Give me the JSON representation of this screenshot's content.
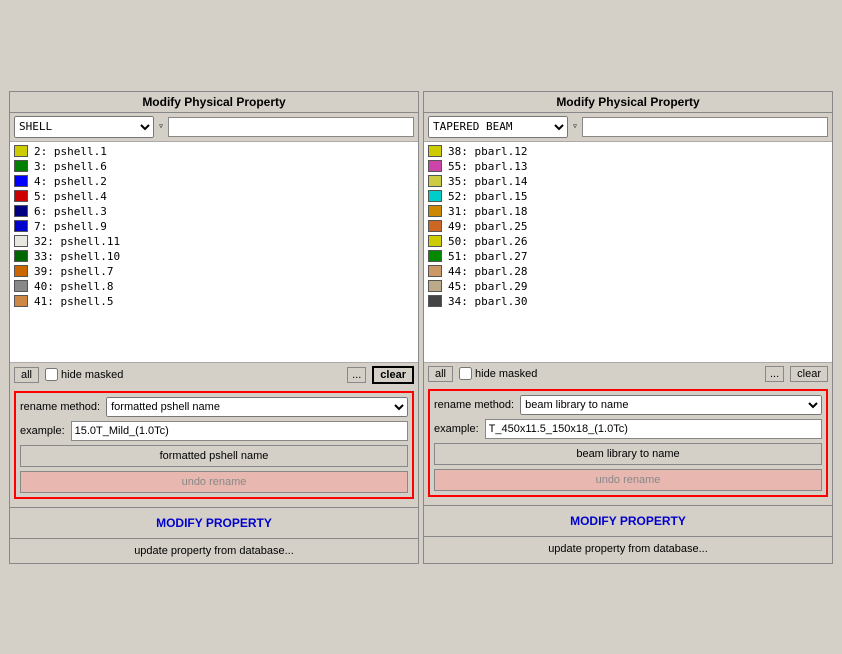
{
  "left_panel": {
    "title": "Modify Physical Property",
    "property_type": "SHELL",
    "filter_placeholder": "",
    "items": [
      {
        "id": "2",
        "name": "pshell.1",
        "color": "#cccc00"
      },
      {
        "id": "3",
        "name": "pshell.6",
        "color": "#008000"
      },
      {
        "id": "4",
        "name": "pshell.2",
        "color": "#0000ff"
      },
      {
        "id": "5",
        "name": "pshell.4",
        "color": "#cc0000"
      },
      {
        "id": "6",
        "name": "pshell.3",
        "color": "#000080"
      },
      {
        "id": "7",
        "name": "pshell.9",
        "color": "#0000cc"
      },
      {
        "id": "32",
        "name": "pshell.11",
        "color": "#e8e8e0"
      },
      {
        "id": "33",
        "name": "pshell.10",
        "color": "#006600"
      },
      {
        "id": "39",
        "name": "pshell.7",
        "color": "#cc6600"
      },
      {
        "id": "40",
        "name": "pshell.8",
        "color": "#888888"
      },
      {
        "id": "41",
        "name": "pshell.5",
        "color": "#cc8844"
      }
    ],
    "btn_all": "all",
    "hide_masked_label": "hide masked",
    "btn_dots": "...",
    "btn_clear": "clear",
    "rename_section": {
      "rename_method_label": "rename method:",
      "rename_method_value": "formatted pshell name",
      "rename_method_options": [
        "formatted pshell name",
        "beam library to name"
      ],
      "example_label": "example:",
      "example_value": "15.0T_Mild_(1.0Tc)",
      "btn_rename": "formatted pshell name",
      "btn_undo": "undo rename"
    },
    "btn_modify": "MODIFY PROPERTY",
    "btn_update": "update property from database..."
  },
  "right_panel": {
    "title": "Modify Physical Property",
    "property_type": "TAPERED BEAM",
    "filter_placeholder": "",
    "items": [
      {
        "id": "38",
        "name": "pbarl.12",
        "color": "#cccc00"
      },
      {
        "id": "55",
        "name": "pbarl.13",
        "color": "#cc44aa"
      },
      {
        "id": "35",
        "name": "pbarl.14",
        "color": "#cccc44"
      },
      {
        "id": "52",
        "name": "pbarl.15",
        "color": "#00cccc"
      },
      {
        "id": "31",
        "name": "pbarl.18",
        "color": "#cc8800"
      },
      {
        "id": "49",
        "name": "pbarl.25",
        "color": "#cc6622"
      },
      {
        "id": "50",
        "name": "pbarl.26",
        "color": "#cccc00"
      },
      {
        "id": "51",
        "name": "pbarl.27",
        "color": "#008800"
      },
      {
        "id": "44",
        "name": "pbarl.28",
        "color": "#cc9966"
      },
      {
        "id": "45",
        "name": "pbarl.29",
        "color": "#bbaa88"
      },
      {
        "id": "34",
        "name": "pbarl.30",
        "color": "#444444"
      }
    ],
    "btn_all": "all",
    "hide_masked_label": "hide masked",
    "btn_dots": "...",
    "btn_clear": "clear",
    "rename_section": {
      "rename_method_label": "rename method:",
      "rename_method_value": "beam library to name",
      "rename_method_options": [
        "formatted pshell name",
        "beam library to name"
      ],
      "example_label": "example:",
      "example_value": "T_450x11.5_150x18_(1.0Tc)",
      "btn_rename": "beam library to name",
      "btn_undo": "undo rename"
    },
    "btn_modify": "MODIFY PROPERTY",
    "btn_update": "update property from database..."
  }
}
